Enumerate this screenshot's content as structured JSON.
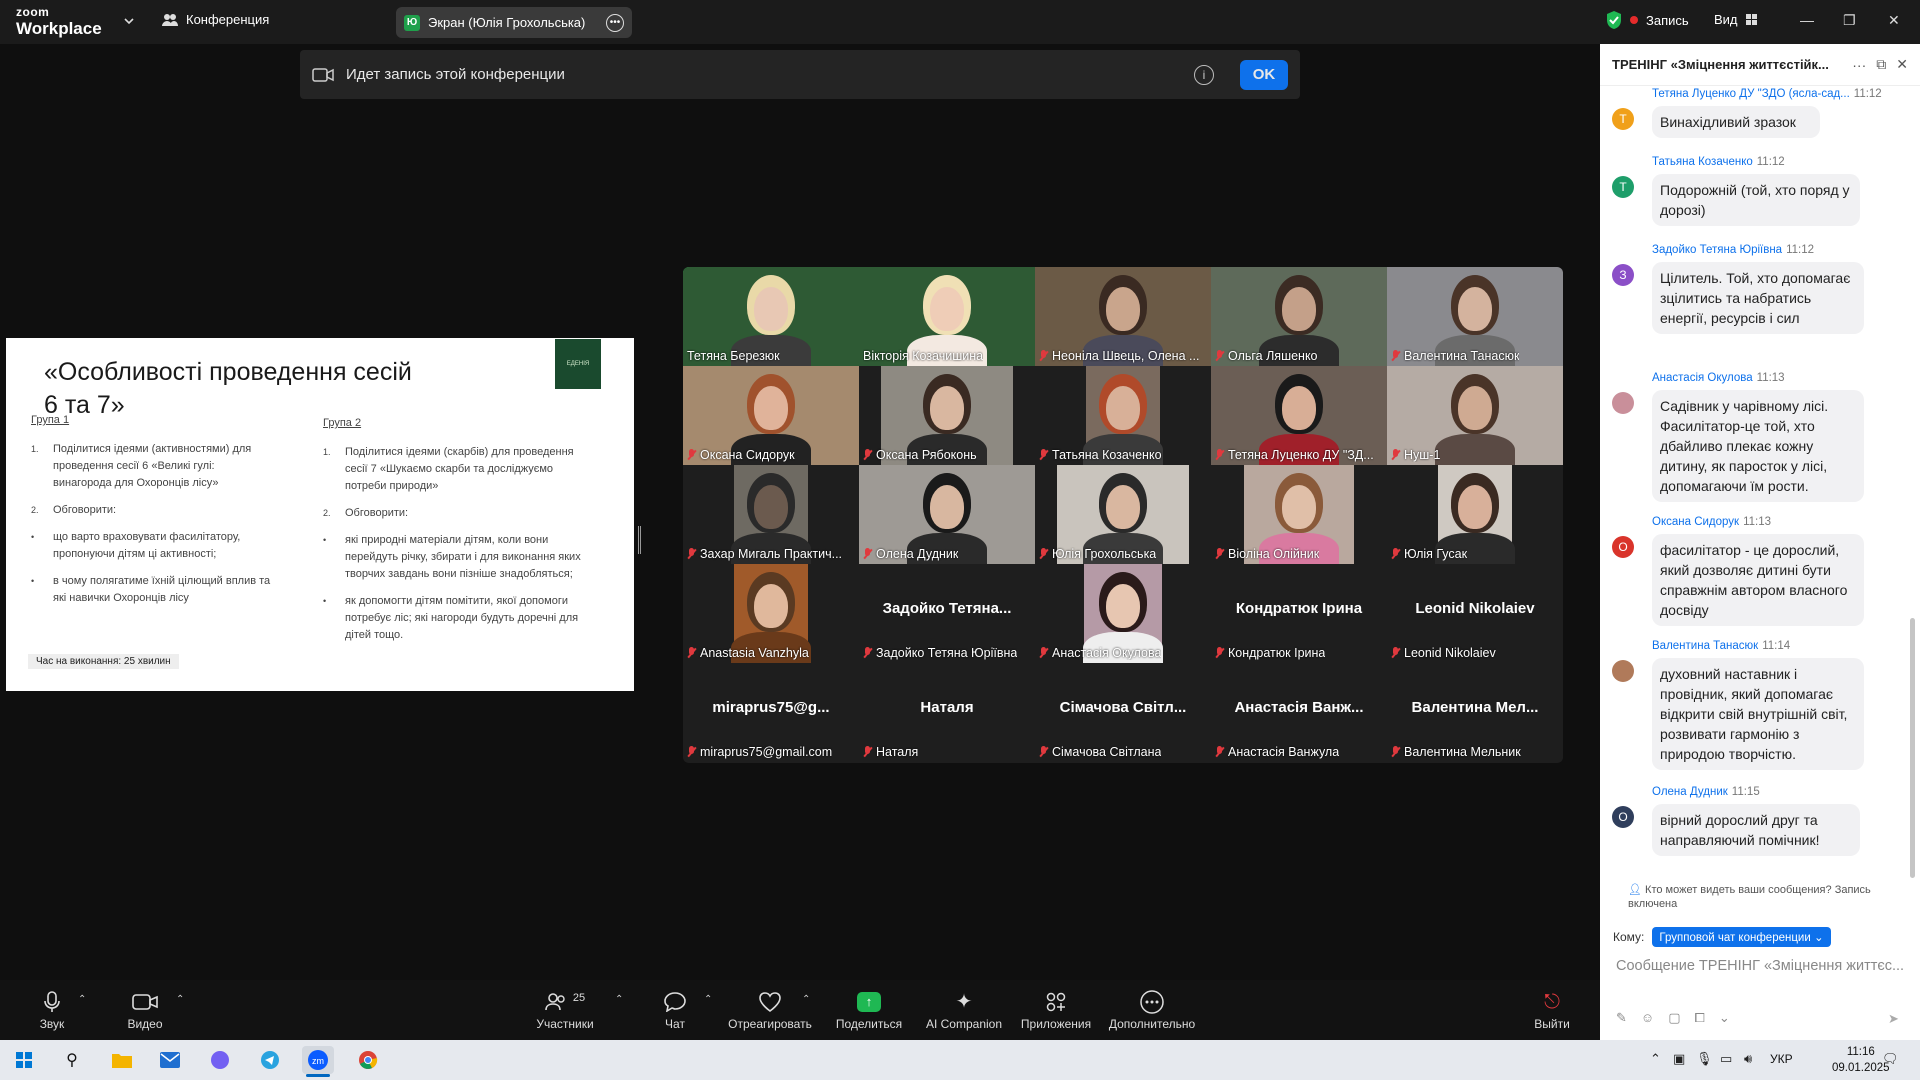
{
  "topbar": {
    "logo_line1": "zoom",
    "logo_line2": "Workplace",
    "conference_label": "Конференция",
    "screen_avatar": "Ю",
    "screen_label": "Экран (Юлія Грохольська)",
    "record_label": "Запись",
    "view_label": "Вид"
  },
  "banner": {
    "text": "Идет запись этой конференции",
    "ok_label": "OK"
  },
  "slide": {
    "title": "«Особливості проведення сесій 6 та 7»",
    "emblem_text": "ЕДЕНІЯ",
    "group1": {
      "heading": "Група 1",
      "items": [
        {
          "n": "1.",
          "text": "Поділитися ідеями (активностями) для проведення  сесії 6 «Великі гулі: винагорода для Охоронців лісу»"
        },
        {
          "n": "2.",
          "text": "Обговорити:"
        },
        {
          "n": "•",
          "text": "що варто враховувати фасилітатору, пропонуючи дітям ці активності;"
        },
        {
          "n": "•",
          "text": "в чому полягатиме їхній цілющий вплив та які навички Охоронців лісу"
        }
      ]
    },
    "group2": {
      "heading": "Група 2",
      "items": [
        {
          "n": "1.",
          "text": "Поділитися ідеями (скарбів) для проведення сесії 7 «Шукаємо скарби та досліджуємо потреби природи»"
        },
        {
          "n": "2.",
          "text": "Обговорити:"
        },
        {
          "n": "•",
          "text": "які природні матеріали дітям, коли вони перейдуть річку, збирати і для виконання яких творчих завдань вони пізніше знадобляться;"
        },
        {
          "n": "•",
          "text": "як допомогти дітям помітити, якої допомоги потребує ліс; які нагороди будуть доречні для дітей тощо."
        }
      ]
    },
    "footer": "Час на виконання: 25 хвилин"
  },
  "gallery": {
    "participants": [
      {
        "name": "Тетяна Березюк",
        "big": ""
      },
      {
        "name": "Вікторія Козачишина",
        "big": ""
      },
      {
        "name": "Неоніла Швець, Олена ...",
        "big": ""
      },
      {
        "name": "Ольга Ляшенко",
        "big": ""
      },
      {
        "name": "Валентина Танасюк",
        "big": ""
      },
      {
        "name": "Оксана Сидорук",
        "big": ""
      },
      {
        "name": "Оксана Рябоконь",
        "big": ""
      },
      {
        "name": "Татьяна Козаченко",
        "big": ""
      },
      {
        "name": "Тетяна Луценко ДУ \"ЗД...",
        "big": ""
      },
      {
        "name": "Нуш-1",
        "big": ""
      },
      {
        "name": "Захар Мигаль Практич...",
        "big": ""
      },
      {
        "name": "Олена Дудник",
        "big": ""
      },
      {
        "name": "Юлія Грохольська",
        "big": ""
      },
      {
        "name": "Віоліна Олійник",
        "big": ""
      },
      {
        "name": "Юлія Гусак",
        "big": ""
      },
      {
        "name": "Anastasia Vanzhyla",
        "big": ""
      },
      {
        "name": "Задойко Тетяна Юріївна",
        "big": "Задойко  Тетяна..."
      },
      {
        "name": "Анастасія Окулова",
        "big": ""
      },
      {
        "name": "Кондратюк Ірина",
        "big": "Кондратюк Ірина"
      },
      {
        "name": "Leonid Nikolaiev",
        "big": "Leonid Nikolaiev"
      },
      {
        "name": "miraprus75@gmail.com",
        "big": "miraprus75@g..."
      },
      {
        "name": "Наталя",
        "big": "Наталя"
      },
      {
        "name": "Сімачова Світлана",
        "big": "Сімачова Світл..."
      },
      {
        "name": "Анастасія Ванжула",
        "big": "Анастасія Ванж..."
      },
      {
        "name": "Валентина Мельник",
        "big": "Валентина Мел..."
      }
    ]
  },
  "chat": {
    "title": "ТРЕНІНГ «Зміцнення життєстійк...",
    "messages": [
      {
        "avatar": "Т",
        "color": "#f0a01a",
        "who": "Тетяна Луценко ДУ \"ЗДО (ясла-сад...",
        "time": "11:12",
        "text": "Винахідливий зразок"
      },
      {
        "avatar": "Т",
        "color": "#1e9e6a",
        "who": "Татьяна Козаченко",
        "time": "11:12",
        "text": "Подорожній (той, хто поряд у дорозі)"
      },
      {
        "avatar": "З",
        "color": "#8b4fc7",
        "who": "Задойко Тетяна Юріївна",
        "time": "11:12",
        "text": "Цілитель. Той, хто допомагає зцілитись та набратись енергії, ресурсів і сил"
      },
      {
        "avatar": "",
        "color": "#c98f9a",
        "who": "Анастасія Окулова",
        "time": "11:13",
        "text": "Садівник у чарівному лісі. Фасилітатор-це той, хто дбайливо плекає кожну дитину, як паросток у лісі, допомагаючи їм рости."
      },
      {
        "avatar": "О",
        "color": "#d9342b",
        "who": "Оксана Сидорук",
        "time": "11:13",
        "text": "фасилітатор - це дорослий, який дозволяє дитині бути справжнім автором власного досвіду"
      },
      {
        "avatar": "",
        "color": "#b07a5a",
        "who": "Валентина Танасюк",
        "time": "11:14",
        "text": "духовний наставник і провідник, який допомагає відкрити свій внутрішній світ, розвивати гармонію з природою творчістю."
      },
      {
        "avatar": "О",
        "color": "#2f3e5c",
        "who": "Олена Дудник",
        "time": "11:15",
        "text": "вірний дорослий друг та направляючий помічник!"
      }
    ],
    "visibility_note": "Кто может видеть ваши сообщения? Запись включена",
    "to_label": "Кому:",
    "to_value": "Групповой чат конференции",
    "input_placeholder": "Сообщение ТРЕНІНГ «Зміцнення життєс..."
  },
  "toolbar": {
    "audio": "Звук",
    "video": "Видео",
    "participants": "Участники",
    "participants_count": "25",
    "chat": "Чат",
    "react": "Отреагировать",
    "share": "Поделиться",
    "ai": "AI Companion",
    "apps": "Приложения",
    "more": "Дополнительно",
    "leave": "Выйти"
  },
  "taskbar": {
    "lang": "УКР",
    "time": "11:16",
    "date": "09.01.2025"
  },
  "colors": {
    "accent": "#0e71eb",
    "muted_mic": "#e0393e",
    "active_speaker": "#22c55e",
    "share_green": "#1fb853"
  }
}
